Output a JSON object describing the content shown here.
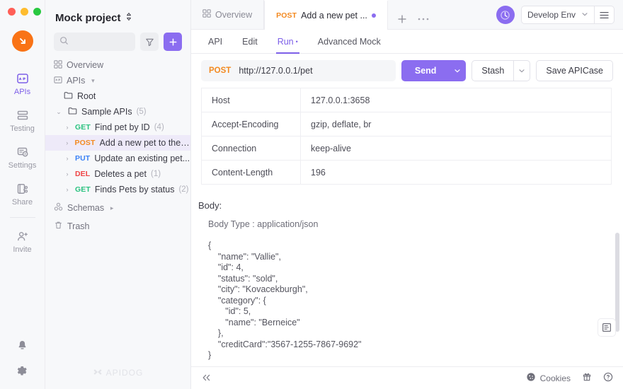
{
  "window": {
    "traffic_lights": [
      "close",
      "minimize",
      "maximize"
    ]
  },
  "rail": {
    "logo": "apidog-logo",
    "items": [
      {
        "label": "APIs",
        "icon": "apis-icon",
        "active": true
      },
      {
        "label": "Testing",
        "icon": "testing-icon",
        "active": false
      },
      {
        "label": "Settings",
        "icon": "settings-icon",
        "active": false
      },
      {
        "label": "Share",
        "icon": "share-icon",
        "active": false
      },
      {
        "label": "Invite",
        "icon": "invite-icon",
        "active": false
      }
    ],
    "bottom": [
      {
        "icon": "bell-icon",
        "label": "Notifications"
      },
      {
        "icon": "gear-icon",
        "label": "Preferences"
      }
    ]
  },
  "sidebar": {
    "project_name": "Mock project",
    "project_switcher_icon": "updown-chevron-icon",
    "search": {
      "placeholder": "",
      "value": "",
      "icon": "search-icon"
    },
    "filter_button": "filter-icon",
    "add_button": "plus-icon",
    "watermark": "APIDOG",
    "tree": [
      {
        "indent": 0,
        "caret": "",
        "icon": "overview-icon",
        "method": "",
        "label": "Overview",
        "count": "",
        "selected": false,
        "muted": true
      },
      {
        "indent": 0,
        "caret": "",
        "icon": "apis-box-icon",
        "method": "",
        "label": "APIs",
        "count": "",
        "selected": false,
        "muted": true,
        "trailing_caret": "▾"
      },
      {
        "indent": 1,
        "caret": "",
        "icon": "folder-icon",
        "method": "",
        "label": "Root",
        "count": "",
        "selected": false,
        "muted": false
      },
      {
        "indent": 2,
        "caret": "⌄",
        "icon": "folder-icon",
        "method": "",
        "label": "Sample APIs",
        "count": "(5)",
        "selected": false,
        "muted": false
      },
      {
        "indent": 3,
        "caret": "›",
        "icon": "",
        "method": "GET",
        "method_class": "m-get",
        "label": "Find pet by ID",
        "count": "(4)",
        "selected": false,
        "muted": false
      },
      {
        "indent": 3,
        "caret": "›",
        "icon": "",
        "method": "POST",
        "method_class": "m-post",
        "label": "Add a new pet to the s...",
        "count": "",
        "selected": true,
        "muted": false
      },
      {
        "indent": 3,
        "caret": "›",
        "icon": "",
        "method": "PUT",
        "method_class": "m-put",
        "label": "Update an existing pet...",
        "count": "",
        "selected": false,
        "muted": false
      },
      {
        "indent": 3,
        "caret": "›",
        "icon": "",
        "method": "DEL",
        "method_class": "m-del",
        "label": "Deletes a pet",
        "count": "(1)",
        "selected": false,
        "muted": false
      },
      {
        "indent": 3,
        "caret": "›",
        "icon": "",
        "method": "GET",
        "method_class": "m-get",
        "label": "Finds Pets by status",
        "count": "(2)",
        "selected": false,
        "muted": false
      },
      {
        "indent": 0,
        "caret": "",
        "icon": "schemas-icon",
        "method": "",
        "label": "Schemas",
        "count": "",
        "selected": false,
        "muted": true,
        "trailing_caret": "▸"
      },
      {
        "indent": 0,
        "caret": "",
        "icon": "trash-icon",
        "method": "",
        "label": "Trash",
        "count": "",
        "selected": false,
        "muted": true
      }
    ]
  },
  "tabbar": {
    "tabs": [
      {
        "label": "Overview",
        "icon": "overview-icon",
        "method": "",
        "active": false,
        "dirty": false
      },
      {
        "label": "Add a new pet ...",
        "icon": "",
        "method": "POST",
        "active": true,
        "dirty": true
      }
    ],
    "new_tab_icon": "plus-icon",
    "more_icon": "ellipsis-icon",
    "avatar_icon": "sync-avatar-icon",
    "environment": "Develop Env",
    "env_chevron_icon": "chevron-down-icon",
    "env_menu_icon": "hamburger-icon"
  },
  "subtabs": [
    {
      "label": "API",
      "active": false,
      "mark": ""
    },
    {
      "label": "Edit",
      "active": false,
      "mark": ""
    },
    {
      "label": "Run",
      "active": true,
      "mark": "•"
    },
    {
      "label": "Advanced Mock",
      "active": false,
      "mark": ""
    }
  ],
  "request": {
    "method": "POST",
    "url": "http://127.0.0.1/pet",
    "send_label": "Send",
    "send_caret_icon": "chevron-down-icon",
    "stash_label": "Stash",
    "stash_caret_icon": "chevron-down-icon",
    "save_label": "Save APICase"
  },
  "headers_table": {
    "rows": [
      {
        "key": "Host",
        "value": "127.0.0.1:3658"
      },
      {
        "key": "Accept-Encoding",
        "value": "gzip, deflate, br"
      },
      {
        "key": "Connection",
        "value": "keep-alive"
      },
      {
        "key": "Content-Length",
        "value": "196"
      }
    ]
  },
  "body": {
    "title": "Body:",
    "body_type": "Body Type : application/json",
    "json": "{\n    \"name\": \"Vallie\",\n    \"id\": 4,\n    \"status\": \"sold\",\n    \"city\": \"Kovacekburgh\",\n    \"category\": {\n       \"id\": 5,\n       \"name\": \"Berneice\"\n    },\n    \"creditCard\":\"3567-1255-7867-9692\"\n}"
  },
  "side_panel_button": "document-panel-icon",
  "statusbar": {
    "collapse_icon": "double-chevron-left-icon",
    "cookies_label": "Cookies",
    "cookies_icon": "cookie-icon",
    "gift_icon": "gift-icon",
    "help_icon": "help-circle-icon"
  },
  "colors": {
    "accent": "#8b6df0",
    "accent_text": "#7d5fe8",
    "logo_orange": "#f97316",
    "method_get": "#29c27f",
    "method_post": "#f38a21",
    "method_put": "#3b82f6",
    "method_del": "#ef4444",
    "sidebar_bg": "#f7f8fa",
    "selected_row": "#eeeaf9"
  }
}
